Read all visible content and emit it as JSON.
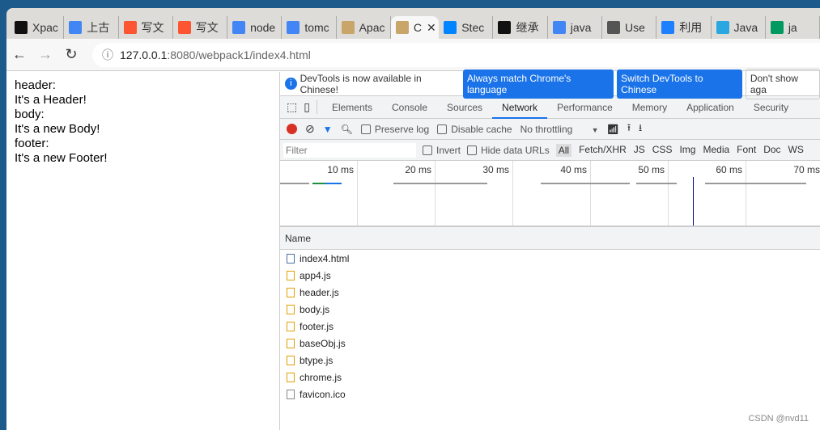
{
  "browser": {
    "tabs": [
      {
        "title": "Xpac",
        "icon": "x-icon",
        "color": "#111"
      },
      {
        "title": "上古",
        "icon": "google-icon",
        "color": "#4285f4"
      },
      {
        "title": "写文",
        "icon": "csdn-icon",
        "color": "#fc5531"
      },
      {
        "title": "写文",
        "icon": "csdn-icon",
        "color": "#fc5531"
      },
      {
        "title": "node",
        "icon": "google-icon",
        "color": "#4285f4"
      },
      {
        "title": "tomc",
        "icon": "google-icon",
        "color": "#4285f4"
      },
      {
        "title": "Apac",
        "icon": "tomcat-icon",
        "color": "#c9a56a"
      },
      {
        "title": "C",
        "icon": "tomcat-icon",
        "color": "#c9a56a",
        "active": true
      },
      {
        "title": "Stec",
        "icon": "zhihu-icon",
        "color": "#0084ff"
      },
      {
        "title": "继承",
        "icon": "m-icon",
        "color": "#111"
      },
      {
        "title": "java",
        "icon": "google-icon",
        "color": "#4285f4"
      },
      {
        "title": "Use",
        "icon": "globe-icon",
        "color": "#555"
      },
      {
        "title": "利用",
        "icon": "juejin-icon",
        "color": "#1e80ff"
      },
      {
        "title": "Java",
        "icon": "cloud-icon",
        "color": "#2aa7e0"
      },
      {
        "title": "ja",
        "icon": "sf-icon",
        "color": "#009a61"
      }
    ],
    "url_host": "127.0.0.1",
    "url_rest": ":8080/webpack1/index4.html"
  },
  "page": {
    "lines": [
      "header:",
      "It's a Header!",
      "body:",
      "It's a new Body!",
      "footer:",
      "It's a new Footer!"
    ]
  },
  "devtools": {
    "info_text": "DevTools is now available in Chinese!",
    "btn_match": "Always match Chrome's language",
    "btn_switch": "Switch DevTools to Chinese",
    "btn_dont": "Don't show aga",
    "tabs": [
      "Elements",
      "Console",
      "Sources",
      "Network",
      "Performance",
      "Memory",
      "Application",
      "Security"
    ],
    "active_tab": "Network",
    "preserve_log": "Preserve log",
    "disable_cache": "Disable cache",
    "throttling": "No throttling",
    "filter_placeholder": "Filter",
    "invert": "Invert",
    "hide_data_urls": "Hide data URLs",
    "types": [
      "All",
      "Fetch/XHR",
      "JS",
      "CSS",
      "Img",
      "Media",
      "Font",
      "Doc",
      "WS"
    ],
    "ticks": [
      "10 ms",
      "20 ms",
      "30 ms",
      "40 ms",
      "50 ms",
      "60 ms",
      "70 ms"
    ],
    "name_header": "Name",
    "files": [
      {
        "name": "index4.html",
        "type": "doc"
      },
      {
        "name": "app4.js",
        "type": "js"
      },
      {
        "name": "header.js",
        "type": "js"
      },
      {
        "name": "body.js",
        "type": "js"
      },
      {
        "name": "footer.js",
        "type": "js"
      },
      {
        "name": "baseObj.js",
        "type": "js"
      },
      {
        "name": "btype.js",
        "type": "js"
      },
      {
        "name": "chrome.js",
        "type": "js"
      },
      {
        "name": "favicon.ico",
        "type": "blank"
      }
    ]
  },
  "watermark": "CSDN @nvd11"
}
